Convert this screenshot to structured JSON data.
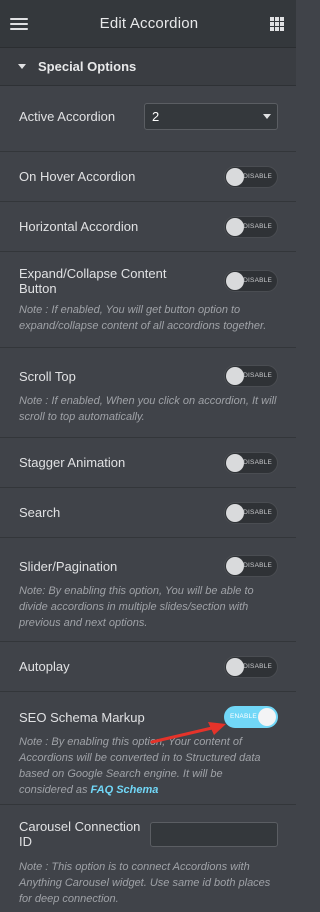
{
  "header": {
    "title": "Edit Accordion"
  },
  "section": {
    "label": "Special Options"
  },
  "active_accordion": {
    "label": "Active Accordion",
    "value": "2"
  },
  "on_hover": {
    "label": "On Hover Accordion",
    "toggle": "DISABLE"
  },
  "horizontal": {
    "label": "Horizontal Accordion",
    "toggle": "DISABLE"
  },
  "expand_collapse": {
    "label_line1": "Expand/Collapse Content",
    "label_line2": "Button",
    "toggle": "DISABLE",
    "note": "Note : If enabled, You will get button option to expand/collapse content of all accordions together."
  },
  "scroll_top": {
    "label": "Scroll Top",
    "toggle": "DISABLE",
    "note": "Note : If enabled, When you click on accordion, It will scroll to top automatically."
  },
  "stagger": {
    "label": "Stagger Animation",
    "toggle": "DISABLE"
  },
  "search": {
    "label": "Search",
    "toggle": "DISABLE"
  },
  "slider": {
    "label": "Slider/Pagination",
    "toggle": "DISABLE",
    "note": "Note: By enabling this option, You will be able to divide accordions in multiple slides/section with previous and next options."
  },
  "autoplay": {
    "label": "Autoplay",
    "toggle": "DISABLE"
  },
  "seo_schema": {
    "label": "SEO Schema Markup",
    "toggle": "ENABLE",
    "note": "Note : By enabling this option, Your content of Accordions will be converted in to Structured data based on Google Search engine. It will be considered as ",
    "link": "FAQ Schema"
  },
  "carousel": {
    "label": "Carousel Connection ID",
    "value": "",
    "note": "Note : This option is to connect Accordions with Anything Carousel widget. Use same id both places for deep connection."
  },
  "colors": {
    "accent": "#71d7f7",
    "panel": "#404349",
    "header": "#34383c",
    "arrow": "#e5332a"
  }
}
